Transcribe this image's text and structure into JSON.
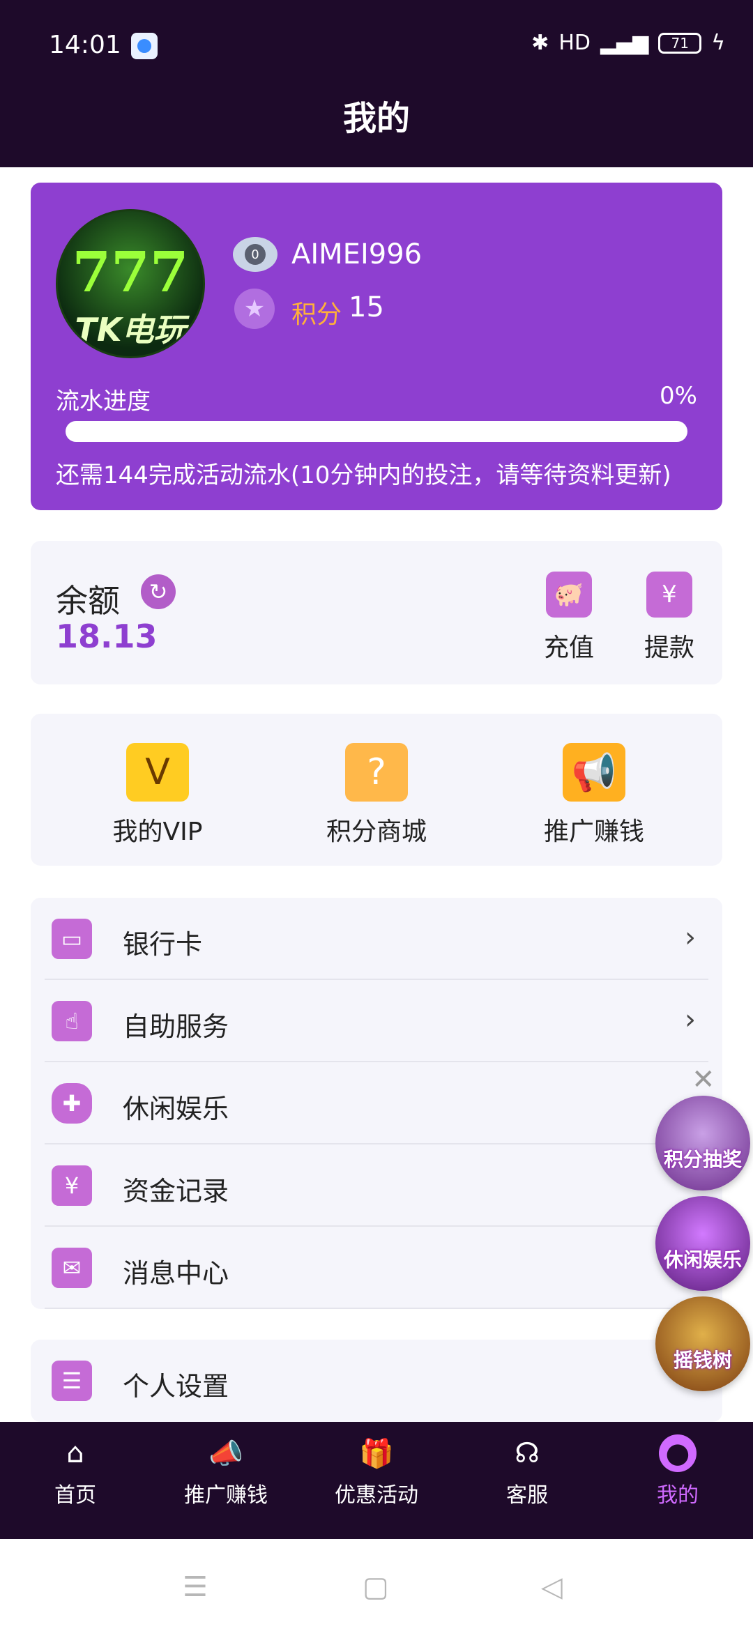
{
  "status_bar": {
    "time": "14:01",
    "network": "HD",
    "signal": "⁴ᴳ",
    "battery": "71"
  },
  "header": {
    "title": "我的"
  },
  "profile": {
    "avatar_text": "777",
    "avatar_brand": "TK电玩",
    "level": "0",
    "username": "AIMEI996",
    "points_label": "积分",
    "points_value": "15",
    "progress_label": "流水进度",
    "progress_percent": "0%",
    "progress_fraction": 0,
    "progress_note": "还需144完成活动流水(10分钟内的投注，请等待资料更新)"
  },
  "balance": {
    "label": "余额",
    "value": "18.13",
    "actions": [
      {
        "label": "充值",
        "icon": "piggy-bank-icon"
      },
      {
        "label": "提款",
        "icon": "yuan-withdraw-icon"
      }
    ]
  },
  "quick_links": [
    {
      "label": "我的VIP",
      "icon": "diamond-v-icon"
    },
    {
      "label": "积分商城",
      "icon": "gift-box-icon"
    },
    {
      "label": "推广赚钱",
      "icon": "megaphone-icon"
    }
  ],
  "menu": [
    {
      "label": "银行卡",
      "icon": "bank-card-icon"
    },
    {
      "label": "自助服务",
      "icon": "hand-pointer-icon"
    },
    {
      "label": "休闲娱乐",
      "icon": "gamepad-icon"
    },
    {
      "label": "资金记录",
      "icon": "money-record-icon"
    },
    {
      "label": "消息中心",
      "icon": "envelope-icon"
    }
  ],
  "settings": {
    "label": "个人设置",
    "icon": "id-card-icon"
  },
  "floating": [
    {
      "label": "积分抽奖"
    },
    {
      "label": "休闲娱乐"
    },
    {
      "label": "摇钱树"
    }
  ],
  "tabs": [
    {
      "label": "首页",
      "icon": "home-icon"
    },
    {
      "label": "推广赚钱",
      "icon": "megaphone-icon"
    },
    {
      "label": "优惠活动",
      "icon": "gift-icon"
    },
    {
      "label": "客服",
      "icon": "headset-icon"
    },
    {
      "label": "我的",
      "icon": "user-icon"
    }
  ],
  "colors": {
    "header_bg": "#1e0a2a",
    "card": "#8e3fd0",
    "accent": "#c56bd6",
    "points": "#ffb03a"
  }
}
